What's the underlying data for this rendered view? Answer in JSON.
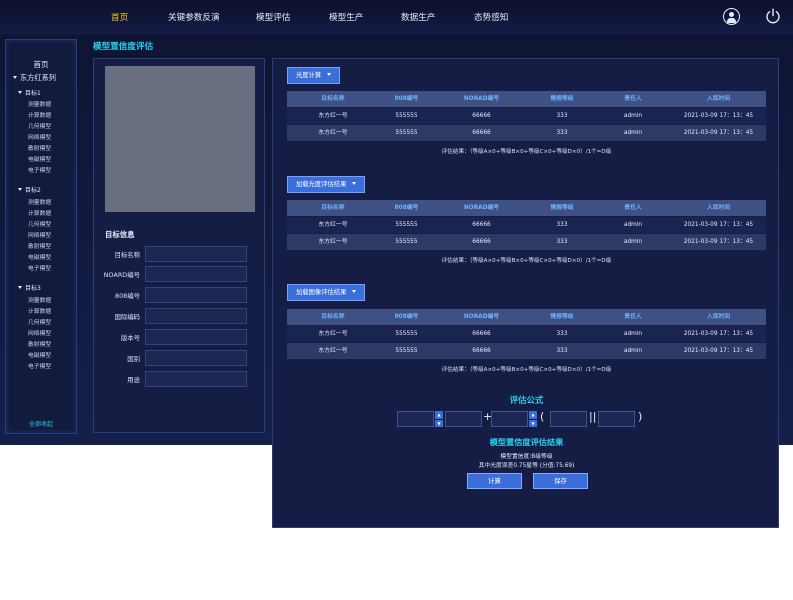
{
  "nav": {
    "items": [
      {
        "label": "首页",
        "active": true
      },
      {
        "label": "关键参数反演",
        "active": false
      },
      {
        "label": "模型评估",
        "active": false
      },
      {
        "label": "模型生产",
        "active": false
      },
      {
        "label": "数据生产",
        "active": false
      },
      {
        "label": "态势感知",
        "active": false
      }
    ],
    "active_color": "#f2c418"
  },
  "sidebar": {
    "home": "首页",
    "root": "东方红系列",
    "groups": [
      {
        "label": "目标1",
        "items": [
          "测量数据",
          "计算数据",
          "几何模型",
          "网络模型",
          "散射模型",
          "电磁模型",
          "电子模型"
        ]
      },
      {
        "label": "目标2",
        "items": [
          "测量数据",
          "计算数据",
          "几何模型",
          "网络模型",
          "散射模型",
          "电磁模型",
          "电子模型"
        ]
      },
      {
        "label": "目标3",
        "items": [
          "测量数据",
          "计算数据",
          "几何模型",
          "网络模型",
          "散射模型",
          "电磁模型",
          "电子模型"
        ]
      }
    ],
    "collapse_all": "全部收起"
  },
  "page": {
    "title": "模型置信度评估"
  },
  "info": {
    "title": "目标信息",
    "fields": [
      {
        "label": "目标名称",
        "value": ""
      },
      {
        "label": "NOARD编号",
        "value": ""
      },
      {
        "label": "808编号",
        "value": ""
      },
      {
        "label": "国际编码",
        "value": ""
      },
      {
        "label": "版本号",
        "value": ""
      },
      {
        "label": "国别",
        "value": ""
      },
      {
        "label": "用途",
        "value": ""
      }
    ]
  },
  "columns": [
    "目标名称",
    "808编号",
    "NORAD编号",
    "情报等级",
    "责任人",
    "入库时间"
  ],
  "sections": [
    {
      "button": "光度计算",
      "rows": [
        [
          "东方红一号",
          "555555",
          "66666",
          "333",
          "admin",
          "2021-03-09 17：13：45"
        ],
        [
          "东方红一号",
          "555555",
          "66666",
          "333",
          "admin",
          "2021-03-09 17：13：45"
        ]
      ],
      "result": "评估结果：（等级A×0+等级B×0+等级C×0+等级D×0）/1个=D级"
    },
    {
      "button": "加载光度评估结果",
      "rows": [
        [
          "东方红一号",
          "555555",
          "66666",
          "333",
          "admin",
          "2021-03-09 17：13：45"
        ],
        [
          "东方红一号",
          "555555",
          "66666",
          "333",
          "admin",
          "2021-03-09 17：13：45"
        ]
      ],
      "result": "评估结果：（等级A×0+等级B×0+等级C×0+等级D×0）/1个=D级"
    },
    {
      "button": "加载图像评估结果",
      "rows": [
        [
          "东方红一号",
          "555555",
          "66666",
          "333",
          "admin",
          "2021-03-09 17：13：45"
        ],
        [
          "东方红一号",
          "555555",
          "66666",
          "333",
          "admin",
          "2021-03-09 17：13：45"
        ]
      ],
      "result": "评估结果：（等级A×0+等级B×0+等级C×0+等级D×0）/1个=D级"
    }
  ],
  "formula": {
    "title": "评估公式",
    "plus": "+",
    "open_paren": "(",
    "separator": "||",
    "close_paren": ")"
  },
  "result": {
    "title": "模型置信度评估结果",
    "line1": "模型置信度:B级等级",
    "line2": "其中光度误差0.75星等 (分值:75.69)",
    "calc_button": "计算",
    "save_button": "保存"
  }
}
